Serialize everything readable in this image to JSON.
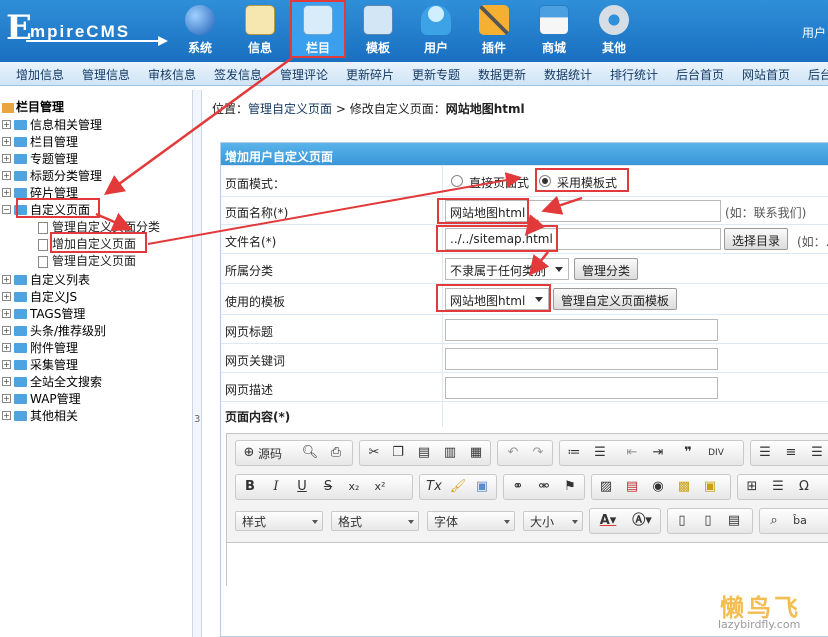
{
  "header": {
    "logo": {
      "first": "E",
      "rest": "mpireCMS"
    },
    "nav": [
      {
        "label": "系统",
        "icon": "globe-icon",
        "color": "#3b8ee0"
      },
      {
        "label": "信息",
        "icon": "edit-document-icon",
        "color": "#e8c870"
      },
      {
        "label": "栏目",
        "icon": "folder-icon",
        "color": "#8ec6f0"
      },
      {
        "label": "模板",
        "icon": "template-window-icon",
        "color": "#a9cfee"
      },
      {
        "label": "用户",
        "icon": "user-icon",
        "color": "#7fc8f5"
      },
      {
        "label": "插件",
        "icon": "tools-icon",
        "color": "#f0a030"
      },
      {
        "label": "商城",
        "icon": "shop-card-icon",
        "color": "#6ab8e8"
      },
      {
        "label": "其他",
        "icon": "gear-icon",
        "color": "#cfd8e0"
      }
    ],
    "user_label": "用户"
  },
  "subnav": [
    "增加信息",
    "管理信息",
    "审核信息",
    "签发信息",
    "管理评论",
    "更新碎片",
    "更新专题",
    "数据更新",
    "数据统计",
    "排行统计",
    "后台首页",
    "网站首页",
    "后台"
  ],
  "sidebar": {
    "root": "栏目管理",
    "items": [
      "信息相关管理",
      "栏目管理",
      "专题管理",
      "标题分类管理",
      "碎片管理",
      "自定义页面",
      "自定义列表",
      "自定义JS",
      "TAGS管理",
      "头条/推荐级别",
      "附件管理",
      "采集管理",
      "全站全文搜索",
      "WAP管理",
      "其他相关"
    ],
    "children": [
      "管理自定义页面分类",
      "增加自定义页面",
      "管理自定义页面"
    ]
  },
  "splitter_mark": "3",
  "breadcrumb": {
    "prefix": "位置：",
    "link": "管理自定义页面",
    "sep": " > 修改自定义页面：",
    "current": "网站地图html"
  },
  "form": {
    "title": "增加用户自定义页面",
    "page_mode": {
      "label": "页面模式：",
      "option1": "直接页面式",
      "option2": "采用模板式"
    },
    "page_name": {
      "label": "页面名称(*)",
      "value": "网站地图html",
      "hint": "(如：联系我们)"
    },
    "file_name": {
      "label": "文件名(*)",
      "value": "../../sitemap.html",
      "button": "选择目录",
      "hint": "(如：.."
    },
    "category": {
      "label": "所属分类",
      "value": "不隶属于任何类别",
      "button": "管理分类"
    },
    "template": {
      "label": "使用的模板",
      "value": "网站地图html",
      "button": "管理自定义页面模板"
    },
    "page_title": {
      "label": "网页标题",
      "value": ""
    },
    "keywords": {
      "label": "网页关键词",
      "value": ""
    },
    "description": {
      "label": "网页描述",
      "value": ""
    },
    "content": {
      "label": "页面内容(*)"
    }
  },
  "editor": {
    "source_label": "源码",
    "row1": [
      "source",
      "preview",
      "print",
      "cut",
      "copy",
      "paste",
      "paste-text",
      "paste-word",
      "undo",
      "redo",
      "numbered-list",
      "bulleted-list",
      "outdent",
      "indent",
      "blockquote",
      "div",
      "align-left",
      "align-center",
      "align-right"
    ],
    "row2": [
      "B",
      "I",
      "U",
      "S",
      "x₂",
      "x²",
      "Tx",
      "brush",
      "template",
      "link",
      "unlink",
      "anchor",
      "image",
      "flash",
      "media",
      "smiley",
      "box",
      "table",
      "hr",
      "Ω"
    ],
    "dropdowns": [
      "样式",
      "格式",
      "字体",
      "大小"
    ],
    "row3_icons": [
      "text-color",
      "bg-color",
      "page",
      "new-page",
      "doc",
      "search",
      "replace"
    ]
  },
  "watermark": {
    "text": "懒鸟飞",
    "url": "lazybirdfly.com"
  }
}
